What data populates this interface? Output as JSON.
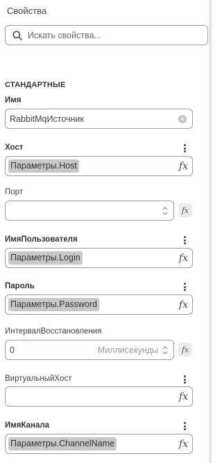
{
  "panel": {
    "title": "Свойства"
  },
  "search": {
    "placeholder": "Искать свойства..."
  },
  "section": {
    "title": "СТАНДАРТНЫЕ"
  },
  "fields": {
    "name": {
      "label": "Имя",
      "value": "RabbitMqИсточник"
    },
    "host": {
      "label": "Хост",
      "value": "Параметры.Host"
    },
    "port": {
      "label": "Порт",
      "value": ""
    },
    "username": {
      "label": "ИмяПользователя",
      "value": "Параметры.Login"
    },
    "password": {
      "label": "Пароль",
      "value": "Параметры.Password"
    },
    "reconnect": {
      "label": "ИнтервалВосстановления",
      "value": "0",
      "unit": "Миллисекунды"
    },
    "vhost": {
      "label": "ВиртуальныйХост",
      "value": ""
    },
    "channel": {
      "label": "ИмяКанала",
      "value": "Параметры.ChannelName"
    }
  },
  "icons": {
    "fx": "fx",
    "kebab": "more-vert-icon",
    "search": "search-icon",
    "clear": "clear-icon",
    "spinner": "spinner-icon"
  }
}
